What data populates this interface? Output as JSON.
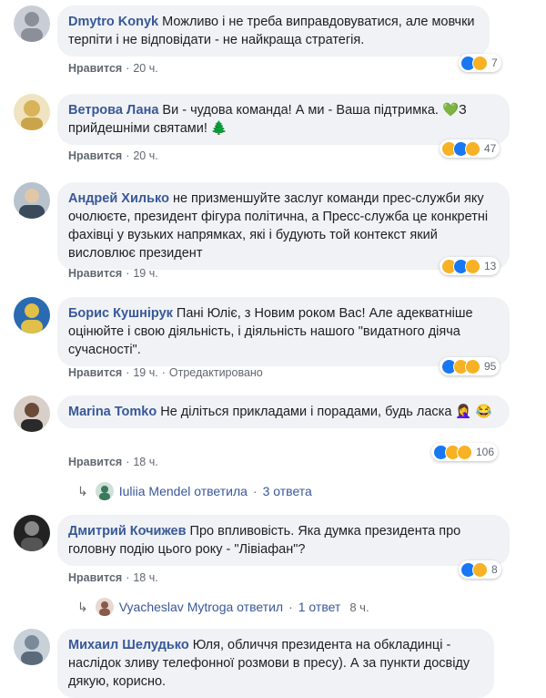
{
  "comments": [
    {
      "author": "Dmytro Konyk",
      "text": "Можливо і не треба виправдовуватися, але мовчки терпіти і не відповідати - не найкраща стратегія.",
      "like_label": "Нравится",
      "time": "20 ч.",
      "edited": "",
      "reaction_count": "7",
      "avatar_color": "#8a8f99"
    },
    {
      "author": "Ветрова Лана",
      "text": "Ви - чудова команда! А ми - Ваша підтримка. 💚З прийдешніми святами! 🌲",
      "like_label": "Нравится",
      "time": "20 ч.",
      "edited": "",
      "reaction_count": "47",
      "avatar_color": "#d9b35a"
    },
    {
      "author": "Андрей Хилько",
      "text": "не призменшуйте заслуг команди прес-служби яку очолюєте, президент фігура політична, а Пресс-служба це конкретні фахівці у вузьких напрямках, які і будують той контекст який висловлює президент",
      "like_label": "Нравится",
      "time": "19 ч.",
      "edited": "",
      "reaction_count": "13",
      "avatar_color": "#5a6a7a"
    },
    {
      "author": "Борис Кушнірук",
      "text": "Пані Юліє, з Новим роком Вас! Але адекватніше оцінюйте і свою діяльність, і діяльність нашого \"видатного діяча сучасності\".",
      "like_label": "Нравится",
      "time": "19 ч.",
      "edited": "Отредактировано",
      "reaction_count": "95",
      "avatar_color": "#e0c048"
    },
    {
      "author": "Marina Tomko",
      "text": "Не діліться прикладами і порадами, будь ласка 🤦‍♀️ 😂",
      "like_label": "Нравится",
      "time": "18 ч.",
      "edited": "",
      "reaction_count": "106",
      "avatar_color": "#6b4a3a"
    },
    {
      "author": "Дмитрий Кочижев",
      "text": "Про впливовість. Яка думка президента про головну подію цього року - \"Лівіафан\"?",
      "like_label": "Нравится",
      "time": "18 ч.",
      "edited": "",
      "reaction_count": "8",
      "avatar_color": "#555555"
    },
    {
      "author": "Михаил Шелудько",
      "text": "Юля, обличчя президента на обкладинці - наслідок зливу телефонної розмови в пресу). А за пункти досвіду дякую, корисно.",
      "avatar_color": "#7a8a9a"
    }
  ],
  "replies": [
    {
      "name": "Iuliia Mendel",
      "action": "ответила",
      "count": "3 ответа",
      "time": "",
      "avatar_color": "#3a7a5a"
    },
    {
      "name": "Vyacheslav Mytroga",
      "action": "ответил",
      "count": "1 ответ",
      "time": "8 ч.",
      "avatar_color": "#8a5a4a"
    }
  ],
  "colors": {
    "like": "#1877f2",
    "haha": "#f7b125",
    "author": "#385898",
    "bubble": "#f0f2f5"
  }
}
